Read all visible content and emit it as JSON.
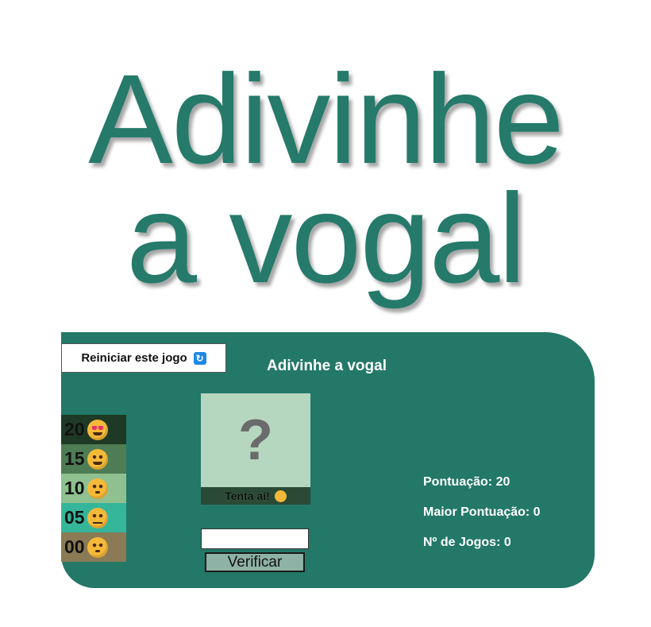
{
  "hero": {
    "line1": "Adivinhe",
    "line2": "a vogal"
  },
  "toolbar": {
    "reset_label": "Reiniciar este jogo",
    "reset_icon": "repeat-icon"
  },
  "panel": {
    "title": "Adivinhe a vogal"
  },
  "scores": [
    {
      "value": "20",
      "emoji": "heart-eyes-emoji",
      "color": "#1f3a24"
    },
    {
      "value": "15",
      "emoji": "grinning-emoji",
      "color": "#4e7c54"
    },
    {
      "value": "10",
      "emoji": "smiling-emoji",
      "color": "#8fc08f"
    },
    {
      "value": "05",
      "emoji": "neutral-emoji",
      "color": "#35b59a"
    },
    {
      "value": "00",
      "emoji": "flushed-emoji",
      "color": "#8a7a55"
    }
  ],
  "card": {
    "symbol": "?",
    "hint": "Tenta aí!",
    "hint_emoji": "winking-emoji"
  },
  "form": {
    "input_value": "",
    "verify_label": "Verificar"
  },
  "stats": {
    "score": "Pontuação: 20",
    "high_score": "Maior Pontuação: 0",
    "games": "Nº de Jogos: 0"
  }
}
